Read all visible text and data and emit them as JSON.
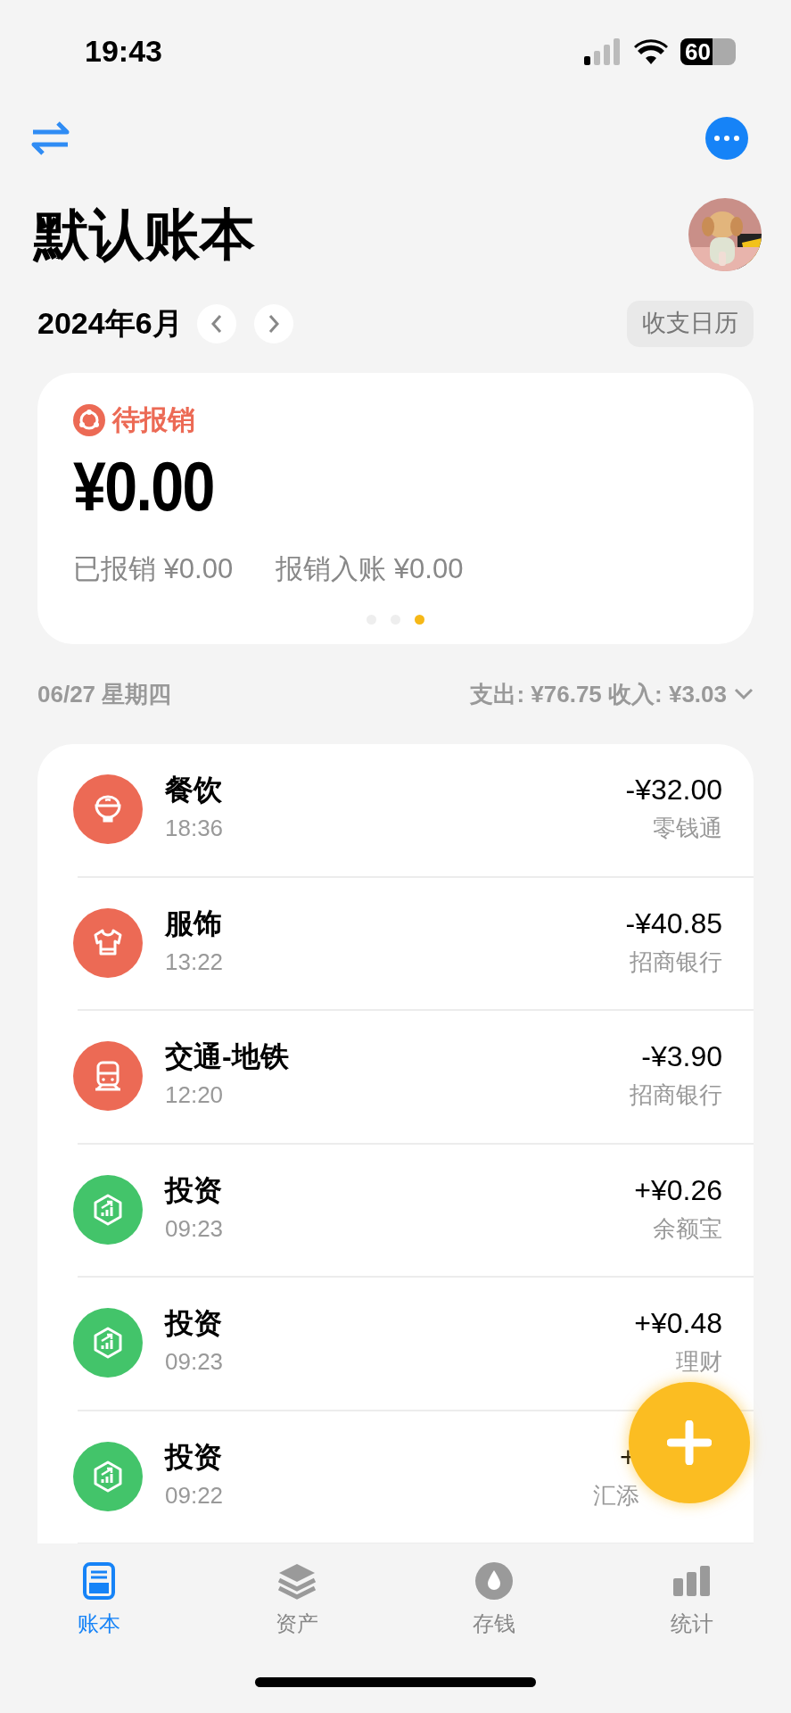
{
  "status_bar": {
    "time": "19:43",
    "battery": "60"
  },
  "title": "默认账本",
  "month": {
    "label": "2024年6月",
    "calendar_button": "收支日历"
  },
  "summary_card": {
    "label": "待报销",
    "amount": "¥0.00",
    "stats": [
      "已报销 ¥0.00",
      "报销入账 ¥0.00"
    ],
    "pages": [
      {
        "selected": false
      },
      {
        "selected": false
      },
      {
        "selected": true
      }
    ]
  },
  "day": {
    "date": "06/27 星期四",
    "totals": "支出: ¥76.75 收入: ¥3.03",
    "expanded": false
  },
  "transactions": [
    {
      "kind": "bowl",
      "color": "#ec6a55",
      "category": "餐饮",
      "time": "18:36",
      "amount": "-¥32.00",
      "account": "零钱通",
      "covered": false
    },
    {
      "kind": "shirt",
      "color": "#ec6a55",
      "category": "服饰",
      "time": "13:22",
      "amount": "-¥40.85",
      "account": "招商银行",
      "covered": false
    },
    {
      "kind": "train",
      "color": "#ec6a55",
      "category": "交通-地铁",
      "time": "12:20",
      "amount": "-¥3.90",
      "account": "招商银行",
      "covered": false
    },
    {
      "kind": "invest",
      "color": "#43c46a",
      "category": "投资",
      "time": "09:23",
      "amount": "+¥0.26",
      "account": "余额宝",
      "covered": false
    },
    {
      "kind": "invest",
      "color": "#43c46a",
      "category": "投资",
      "time": "09:23",
      "amount": "+¥0.48",
      "account": "理财",
      "covered": false
    },
    {
      "kind": "invest",
      "color": "#43c46a",
      "category": "投资",
      "time": "09:22",
      "amount": "+",
      "account": "汇添",
      "covered": true
    }
  ],
  "tab_bar": [
    {
      "kind": "book",
      "label": "账本",
      "selected": true
    },
    {
      "kind": "layers",
      "label": "资产",
      "selected": false
    },
    {
      "kind": "drop",
      "label": "存钱",
      "selected": false
    },
    {
      "kind": "bars",
      "label": "统计",
      "selected": false
    }
  ]
}
